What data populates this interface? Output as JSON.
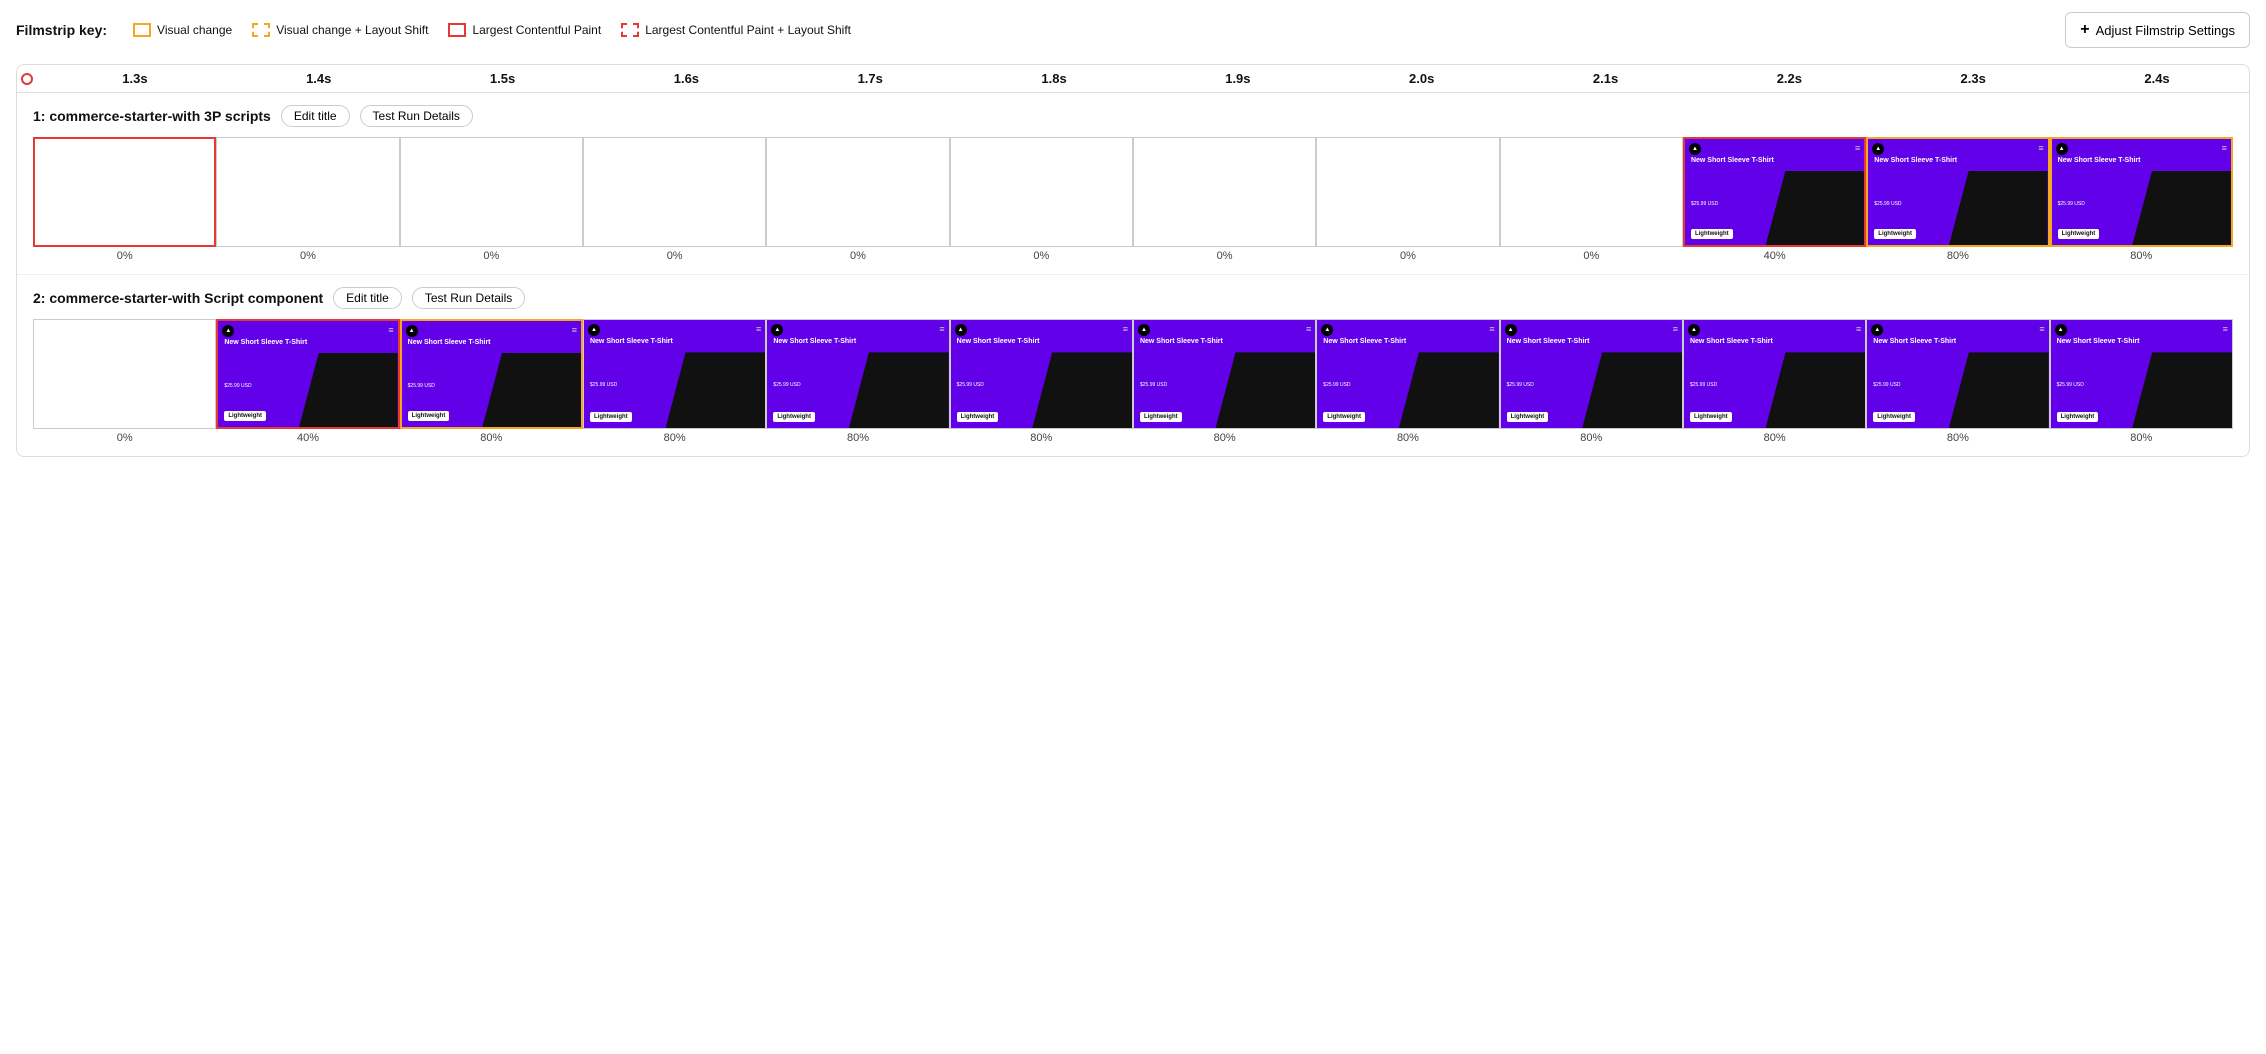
{
  "legend": {
    "label": "Filmstrip key:",
    "items": [
      {
        "id": "visual-change",
        "boxClass": "solid-yellow",
        "text": "Visual change"
      },
      {
        "id": "visual-change-layout-shift",
        "boxClass": "dashed-yellow",
        "text": "Visual change + Layout Shift"
      },
      {
        "id": "lcp",
        "boxClass": "solid-red",
        "text": "Largest Contentful Paint"
      },
      {
        "id": "lcp-layout-shift",
        "boxClass": "dashed-red",
        "text": "Largest Contentful Paint + Layout Shift"
      }
    ],
    "adjust_btn": "Adjust Filmstrip Settings"
  },
  "timeline": {
    "ticks": [
      "1.3s",
      "1.4s",
      "1.5s",
      "1.6s",
      "1.7s",
      "1.8s",
      "1.9s",
      "2.0s",
      "2.1s",
      "2.2s",
      "2.3s",
      "2.4s"
    ]
  },
  "rows": [
    {
      "id": "row1",
      "title": "1: commerce-starter-with 3P scripts",
      "edit_btn": "Edit title",
      "details_btn": "Test Run Details",
      "frames": [
        {
          "border": "border-red",
          "empty": true,
          "pct": "0%"
        },
        {
          "border": "border-gray",
          "empty": true,
          "pct": "0%"
        },
        {
          "border": "border-gray",
          "empty": true,
          "pct": "0%"
        },
        {
          "border": "border-gray",
          "empty": true,
          "pct": "0%"
        },
        {
          "border": "border-gray",
          "empty": true,
          "pct": "0%"
        },
        {
          "border": "border-gray",
          "empty": true,
          "pct": "0%"
        },
        {
          "border": "border-gray",
          "empty": true,
          "pct": "0%"
        },
        {
          "border": "border-gray",
          "empty": true,
          "pct": "0%"
        },
        {
          "border": "border-gray",
          "empty": true,
          "pct": "0%"
        },
        {
          "border": "border-red",
          "empty": false,
          "pct": "40%"
        },
        {
          "border": "border-yellow",
          "empty": false,
          "pct": "80%"
        },
        {
          "border": "border-yellow",
          "empty": false,
          "pct": "80%"
        }
      ]
    },
    {
      "id": "row2",
      "title": "2: commerce-starter-with Script component",
      "edit_btn": "Edit title",
      "details_btn": "Test Run Details",
      "frames": [
        {
          "border": "border-gray",
          "empty": true,
          "pct": "0%"
        },
        {
          "border": "border-red",
          "empty": false,
          "pct": "40%"
        },
        {
          "border": "border-yellow",
          "empty": false,
          "pct": "80%"
        },
        {
          "border": "border-gray",
          "empty": false,
          "pct": "80%"
        },
        {
          "border": "border-gray",
          "empty": false,
          "pct": "80%"
        },
        {
          "border": "border-gray",
          "empty": false,
          "pct": "80%"
        },
        {
          "border": "border-gray",
          "empty": false,
          "pct": "80%"
        },
        {
          "border": "border-gray",
          "empty": false,
          "pct": "80%"
        },
        {
          "border": "border-gray",
          "empty": false,
          "pct": "80%"
        },
        {
          "border": "border-gray",
          "empty": false,
          "pct": "80%"
        },
        {
          "border": "border-gray",
          "empty": false,
          "pct": "80%"
        },
        {
          "border": "border-gray",
          "empty": false,
          "pct": "80%"
        }
      ]
    }
  ],
  "product": {
    "name": "New Short Sleeve T-Shirt",
    "price": "$25.99 USD",
    "badge": "Lightweight"
  }
}
